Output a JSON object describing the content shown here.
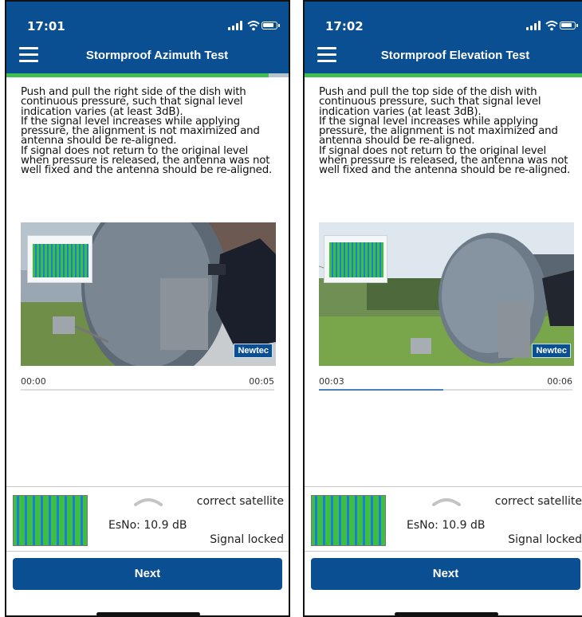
{
  "screens": [
    {
      "status": {
        "time": "17:01"
      },
      "nav": {
        "title": "Stormproof Azimuth Test"
      },
      "progress": 0.93,
      "instruction": [
        "Push and pull the right side of the dish with continuous pressure, such that signal level indication varies (at least 3dB).",
        "If the signal level increases while applying pressure, the alignment is not maximized and antenna should be re-aligned.",
        "If signal does not return to the original level when pressure is released, the antenna was not well fixed and the antenna should be re-aligned."
      ],
      "video": {
        "current": "00:00",
        "total": "00:05",
        "played": 0.0,
        "watermark": "Newtec"
      },
      "panel": {
        "satellite": "correct satellite",
        "esno": "EsNo: 10.9 dB",
        "lock": "Signal locked"
      },
      "next_label": "Next"
    },
    {
      "status": {
        "time": "17:02"
      },
      "nav": {
        "title": "Stormproof Elevation Test"
      },
      "progress": 1.0,
      "instruction": [
        "Push and pull the top side of the dish with continuous pressure, such that signal level indication varies (at least 3dB).",
        "If the signal level increases while applying pressure, the alignment is not maximized and antenna should be re-aligned.",
        "If signal does not return to the original level when pressure is released, the antenna was not well fixed and the antenna should be re-aligned."
      ],
      "video": {
        "current": "00:03",
        "total": "00:06",
        "played": 0.49,
        "watermark": "Newtec"
      },
      "panel": {
        "satellite": "correct satellite",
        "esno": "EsNo: 10.9 dB",
        "lock": "Signal locked"
      },
      "next_label": "Next"
    }
  ],
  "colors": {
    "brand": "#0b4f93",
    "progress": "#3ec152",
    "graph_green": "#3fbf3f",
    "graph_blue": "#1c7fd6"
  },
  "icons": {
    "menu": "hamburger-menu-icon",
    "chevron": "chevron-up-icon",
    "cell": "cellular-signal-icon",
    "wifi": "wifi-icon",
    "battery": "battery-icon"
  }
}
